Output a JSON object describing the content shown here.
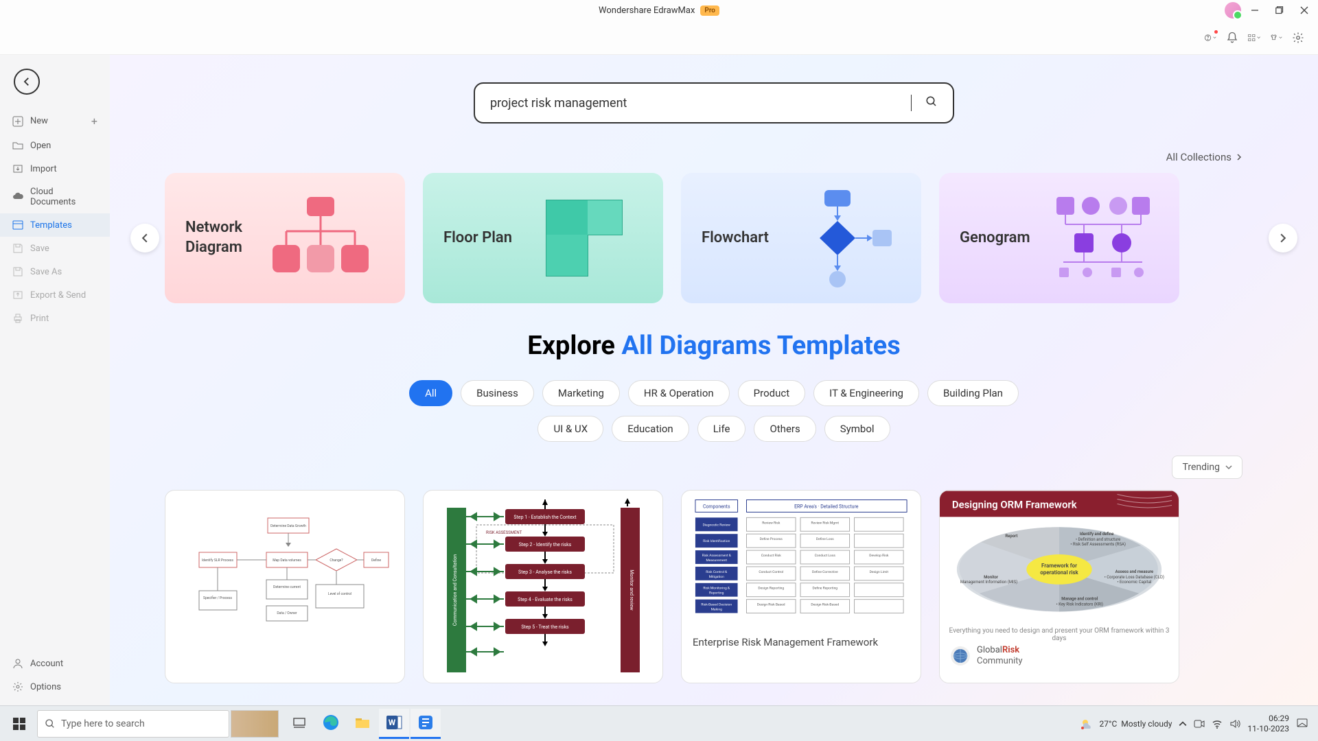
{
  "titlebar": {
    "app_name": "Wondershare EdrawMax",
    "pro": "Pro"
  },
  "sidebar": {
    "new": "New",
    "open": "Open",
    "import": "Import",
    "cloud": "Cloud Documents",
    "templates": "Templates",
    "save": "Save",
    "saveas": "Save As",
    "export": "Export & Send",
    "print": "Print",
    "account": "Account",
    "options": "Options"
  },
  "search": {
    "value": "project risk management"
  },
  "all_collections": "All Collections",
  "collections": [
    {
      "title": "Network\nDiagram"
    },
    {
      "title": "Floor  Plan"
    },
    {
      "title": "Flowchart"
    },
    {
      "title": "Genogram"
    }
  ],
  "explore": {
    "prefix": "Explore ",
    "suffix": "All Diagrams Templates"
  },
  "chips": {
    "all": "All",
    "business": "Business",
    "marketing": "Marketing",
    "hr": "HR & Operation",
    "product": "Product",
    "it": "IT & Engineering",
    "building": "Building Plan",
    "ui": "UI & UX",
    "education": "Education",
    "life": "Life",
    "others": "Others",
    "symbol": "Symbol"
  },
  "sort": "Trending",
  "templates": {
    "t3_title": "Enterprise Risk Management Framework",
    "t4_title": "Designing ORM Framework",
    "t4_sub": "Everything you need to design and present your ORM framework within 3 days",
    "t4_brand1": "GlobalRisk",
    "t4_brand2": "Community"
  },
  "taskbar": {
    "search_placeholder": "Type here to search",
    "temp": "27°C",
    "weather": "Mostly cloudy",
    "time": "06:29",
    "date": "11-10-2023"
  }
}
